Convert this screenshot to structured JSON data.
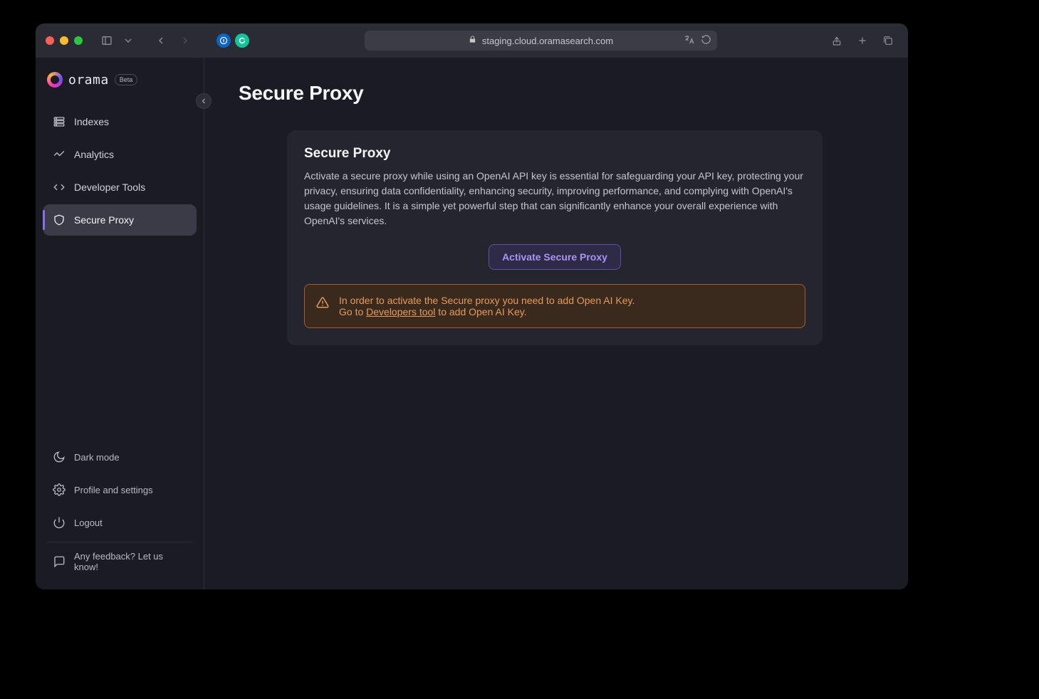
{
  "browser": {
    "url": "staging.cloud.oramasearch.com"
  },
  "brand": {
    "name": "orama",
    "badge": "Beta"
  },
  "nav": {
    "items": [
      {
        "label": "Indexes"
      },
      {
        "label": "Analytics"
      },
      {
        "label": "Developer Tools"
      },
      {
        "label": "Secure Proxy"
      }
    ]
  },
  "sidebar_footer": {
    "dark_mode": "Dark mode",
    "profile": "Profile and settings",
    "logout": "Logout",
    "feedback": "Any feedback? Let us know!"
  },
  "page": {
    "title": "Secure Proxy"
  },
  "card": {
    "title": "Secure Proxy",
    "description": "Activate a secure proxy while using an OpenAI API key is essential for safeguarding your API key, protecting your privacy, ensuring data confidentiality, enhancing security, improving performance, and complying with OpenAI's usage guidelines. It is a simple yet powerful step that can significantly enhance your overall experience with OpenAI's services.",
    "activate_button": "Activate Secure Proxy"
  },
  "alert": {
    "line1": "In order to activate the Secure proxy you need to add Open AI Key.",
    "line2_prefix": "Go to ",
    "line2_link": "Developers tool",
    "line2_suffix": " to add Open AI Key."
  }
}
